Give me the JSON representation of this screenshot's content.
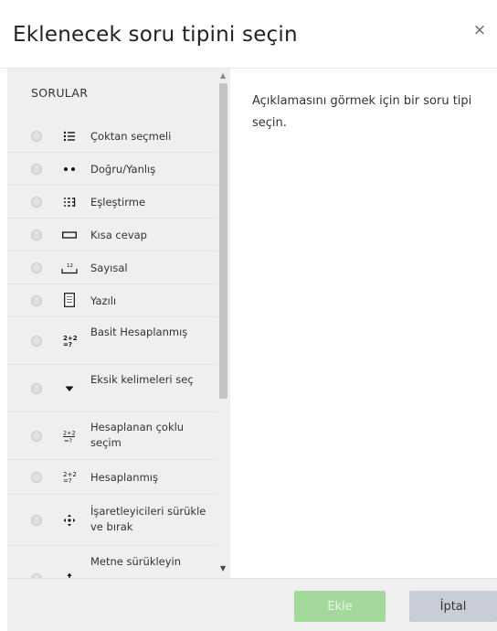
{
  "dialog": {
    "title": "Eklenecek soru tipini seçin",
    "close_glyph": "×"
  },
  "questions": {
    "section_label": "SORULAR",
    "items": [
      {
        "label": "Çoktan seçmeli",
        "icon": "multichoice-icon"
      },
      {
        "label": "Doğru/Yanlış",
        "icon": "truefalse-icon"
      },
      {
        "label": "Eşleştirme",
        "icon": "matching-icon"
      },
      {
        "label": "Kısa cevap",
        "icon": "shortanswer-icon"
      },
      {
        "label": "Sayısal",
        "icon": "numerical-icon"
      },
      {
        "label": "Yazılı",
        "icon": "essay-icon"
      },
      {
        "label": "Basit Hesaplanmış",
        "icon": "calculatedsimple-icon"
      },
      {
        "label": "Eksik kelimeleri seç",
        "icon": "gapselect-icon"
      },
      {
        "label": "Hesaplanan çoklu seçim",
        "icon": "calculatedmulti-icon"
      },
      {
        "label": "Hesaplanmış",
        "icon": "calculated-icon"
      },
      {
        "label": "İşaretleyicileri sürükle ve bırak",
        "icon": "ddmarker-icon"
      },
      {
        "label": "Metne sürükleyin",
        "icon": "ddwtos-icon"
      }
    ]
  },
  "description": {
    "text": "Açıklamasını görmek için bir soru tipi seçin."
  },
  "footer": {
    "add_label": "Ekle",
    "cancel_label": "İptal"
  }
}
